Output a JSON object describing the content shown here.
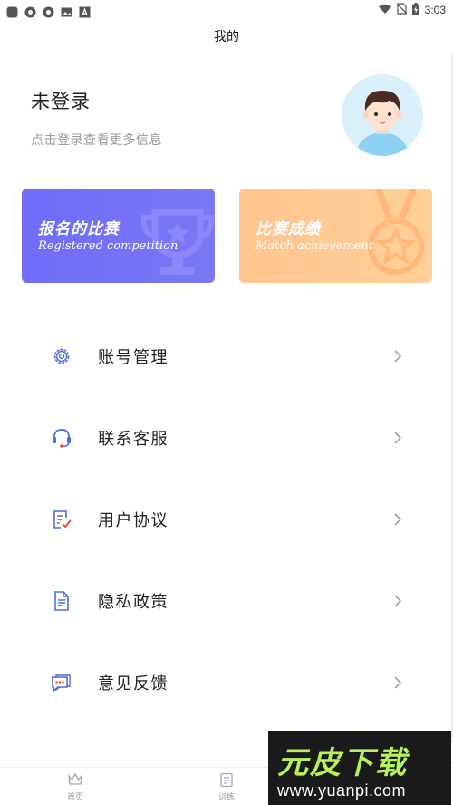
{
  "status_bar": {
    "time": "3:03",
    "left_icons": [
      "app-icon",
      "sync-icon",
      "sync-icon",
      "image-icon",
      "font-icon"
    ],
    "right_icons": [
      "wifi-icon",
      "no-sim-icon",
      "battery-charging-icon"
    ]
  },
  "header": {
    "title": "我的"
  },
  "profile": {
    "name": "未登录",
    "hint": "点击登录查看更多信息",
    "avatar_icon": "user-avatar-icon"
  },
  "cards": [
    {
      "title": "报名的比赛",
      "subtitle": "Registered competition",
      "icon": "trophy-icon",
      "color": "#6f6cf8"
    },
    {
      "title": "比赛成绩",
      "subtitle": "Match achievement",
      "icon": "medal-icon",
      "color": "#ffc58f"
    }
  ],
  "menu": {
    "items": [
      {
        "label": "账号管理",
        "icon": "gear-icon"
      },
      {
        "label": "联系客服",
        "icon": "headset-icon"
      },
      {
        "label": "用户协议",
        "icon": "checklist-icon"
      },
      {
        "label": "隐私政策",
        "icon": "document-icon"
      },
      {
        "label": "意见反馈",
        "icon": "chat-bubble-icon"
      }
    ],
    "chevron_icon": "chevron-right-icon",
    "icon_color": "#4a6fd8"
  },
  "tabbar": {
    "tabs": [
      {
        "label": "首页",
        "icon": "crown-icon"
      },
      {
        "label": "训练",
        "icon": "clipboard-icon"
      },
      {
        "label": "",
        "icon": "user-icon"
      }
    ]
  },
  "watermark": {
    "brand": "元皮下载",
    "url": "www.yuanpi.com"
  }
}
